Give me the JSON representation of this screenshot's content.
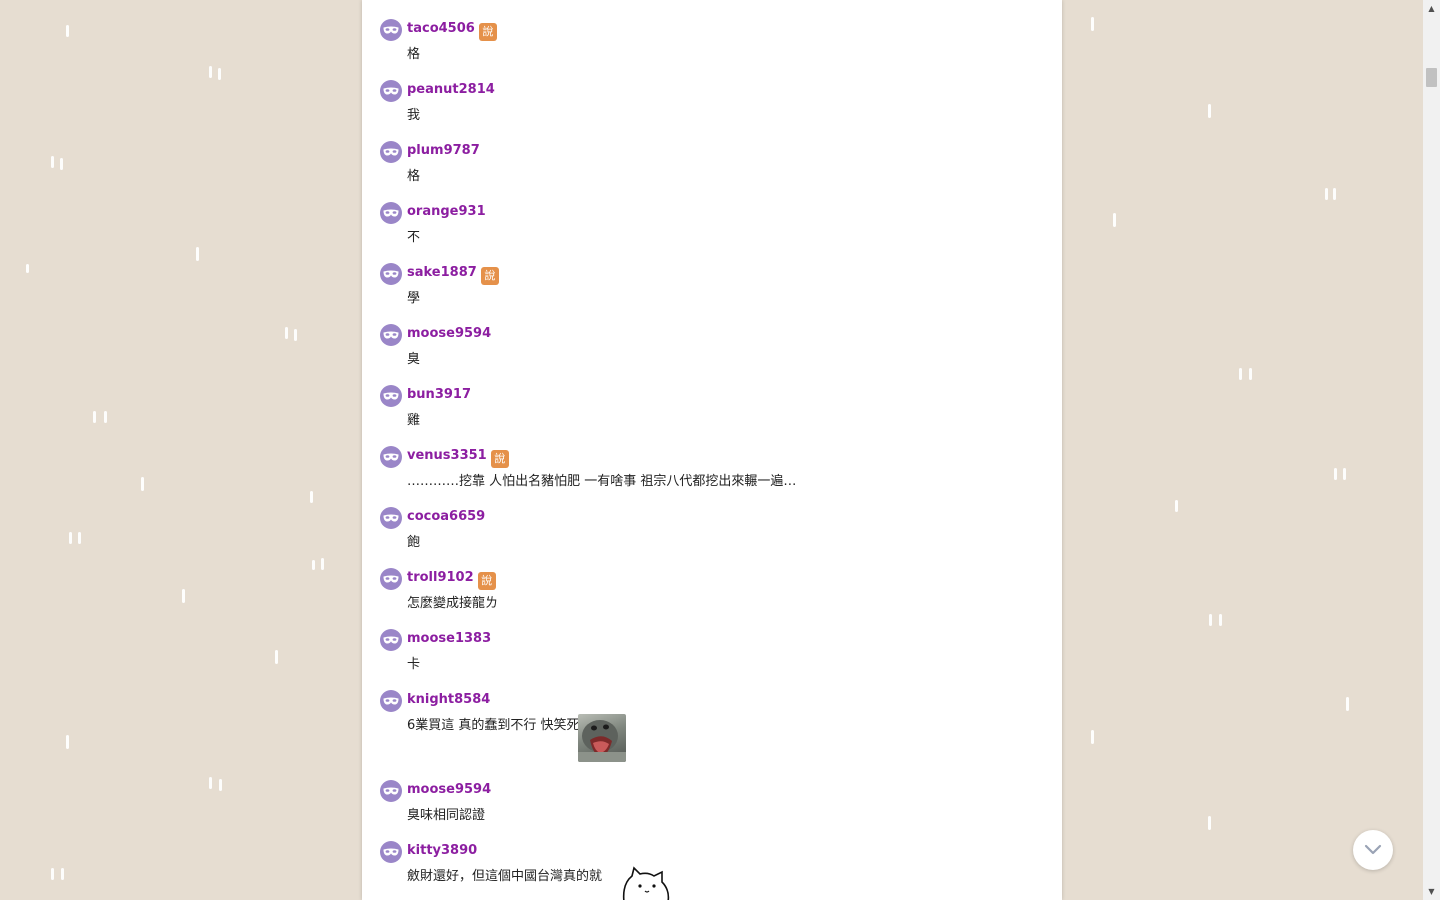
{
  "comments": [
    {
      "username": "taco4506",
      "badge": "說",
      "text": "格"
    },
    {
      "username": "peanut2814",
      "badge": "",
      "text": "我"
    },
    {
      "username": "plum9787",
      "badge": "",
      "text": "格"
    },
    {
      "username": "orange931",
      "badge": "",
      "text": "不"
    },
    {
      "username": "sake1887",
      "badge": "說",
      "text": "學"
    },
    {
      "username": "moose9594",
      "badge": "",
      "text": "臭"
    },
    {
      "username": "bun3917",
      "badge": "",
      "text": "雞"
    },
    {
      "username": "venus3351",
      "badge": "說",
      "text": "…………挖靠 人怕出名豬怕肥 一有啥事 祖宗八代都挖出來輾一遍…"
    },
    {
      "username": "cocoa6659",
      "badge": "",
      "text": "飽"
    },
    {
      "username": "troll9102",
      "badge": "說",
      "text": "怎麼變成接龍ㄌ"
    },
    {
      "username": "moose1383",
      "badge": "",
      "text": "卡"
    },
    {
      "username": "knight8584",
      "badge": "",
      "text": "6業買這 真的蠢到不行 快笑死"
    },
    {
      "username": "moose9594",
      "badge": "",
      "text": "臭味相同認證"
    },
    {
      "username": "kitty3890",
      "badge": "",
      "text": "斂財還好，但這個中國台灣真的就"
    }
  ],
  "icons": {
    "avatar": "masquerade-mask-icon",
    "badge": "speech-badge-icon",
    "scroll_bottom": "chevron-down-icon"
  },
  "colors": {
    "background": "#e6ddd1",
    "username": "#8c1ea1",
    "avatar": "#9a86c8",
    "badge": "#e5914a"
  }
}
